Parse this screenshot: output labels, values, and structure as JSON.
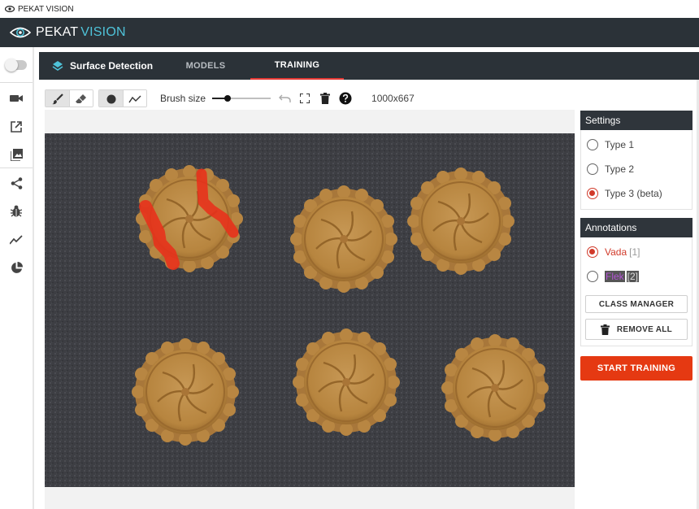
{
  "window": {
    "title": "PEKAT VISION"
  },
  "header": {
    "brand_part1": "PEKAT",
    "brand_part2": "VISION"
  },
  "project": {
    "name": "Surface Detection"
  },
  "tabs": [
    {
      "label": "MODELS",
      "active": false
    },
    {
      "label": "TRAINING",
      "active": true
    }
  ],
  "toolbar": {
    "brush_label": "Brush size",
    "brush_size_fraction": 0.27,
    "image_dimensions": "1000x667"
  },
  "settings": {
    "title": "Settings",
    "options": [
      {
        "label": "Type 1",
        "selected": false
      },
      {
        "label": "Type 2",
        "selected": false
      },
      {
        "label": "Type 3 (beta)",
        "selected": true
      }
    ]
  },
  "annotations": {
    "title": "Annotations",
    "classes": [
      {
        "label": "Vada",
        "count": "[1]",
        "selected": true
      },
      {
        "label": "Flek",
        "count": "[2]",
        "selected": false
      }
    ],
    "class_manager_label": "CLASS MANAGER",
    "remove_all_label": "REMOVE ALL"
  },
  "start_training_label": "START TRAINING",
  "colors": {
    "accent": "#e53912",
    "header_bg": "#2b3238",
    "brand_accent": "#4fc3d9",
    "annotation_red": "#e8301a",
    "flek_purple": "#b455d6"
  },
  "icons": {
    "sidebar": [
      "camera-icon",
      "open-external-icon",
      "image-gallery-icon",
      "share-icon",
      "bug-icon",
      "trending-icon",
      "pie-chart-icon"
    ],
    "toolbar": [
      "brush-icon",
      "eraser-icon",
      "circle-shape-icon",
      "polyline-icon",
      "undo-icon",
      "fullscreen-icon",
      "delete-icon",
      "help-icon"
    ]
  }
}
